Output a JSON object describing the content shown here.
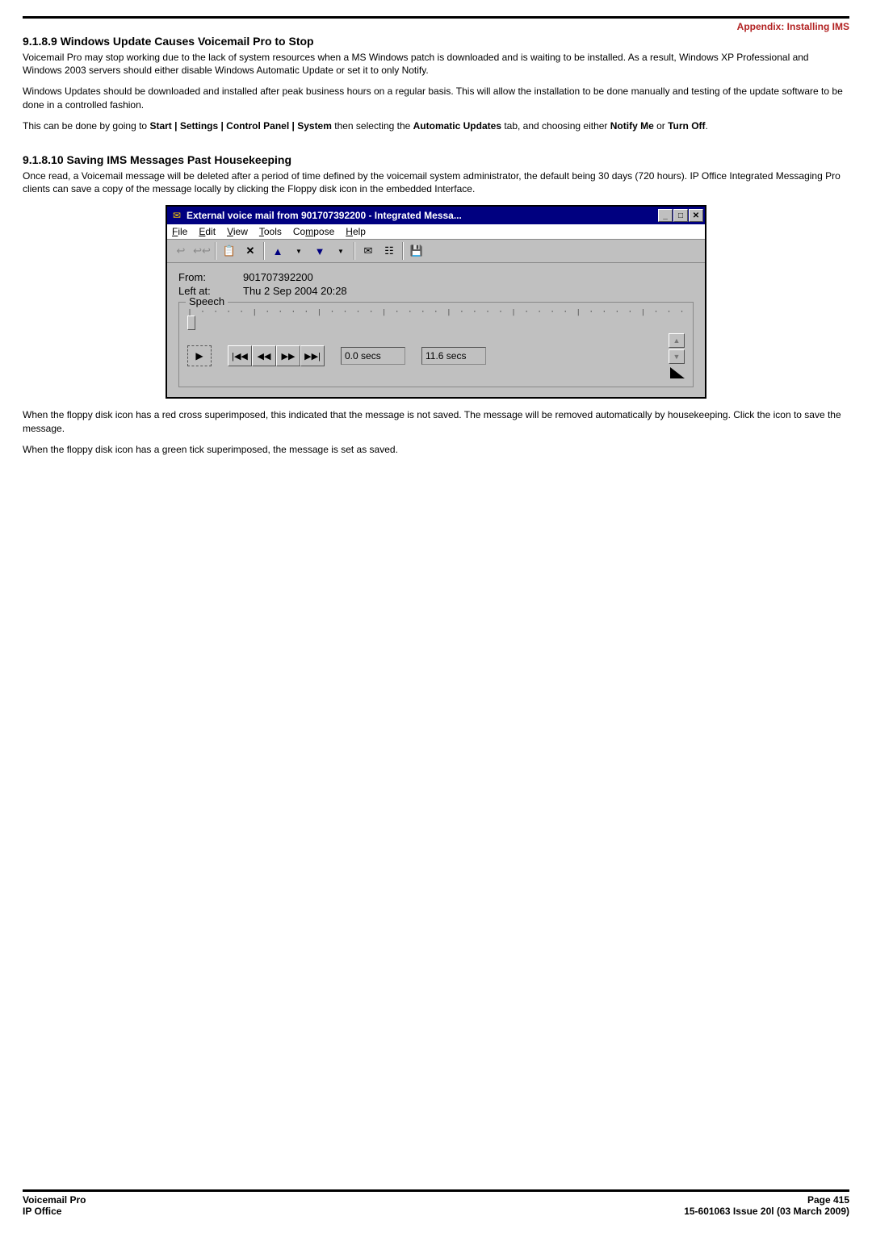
{
  "header": {
    "appendix": "Appendix: Installing IMS"
  },
  "section1": {
    "title": "9.1.8.9 Windows Update Causes Voicemail Pro to Stop",
    "p1": "Voicemail Pro may stop working due to the lack of system resources when a MS Windows patch is downloaded and is waiting to be installed. As a result, Windows XP Professional and Windows 2003 servers should either disable Windows Automatic Update or set it to only Notify.",
    "p2": "Windows Updates should be downloaded and installed after peak business hours on a regular basis. This will allow the installation to be done manually and testing of the update software to be done in a controlled fashion.",
    "p3_a": "This can be done by going to ",
    "p3_b": "Start | Settings | Control Panel | System",
    "p3_c": " then selecting the ",
    "p3_d": "Automatic Updates",
    "p3_e": " tab, and choosing either ",
    "p3_f": "Notify Me",
    "p3_g": " or ",
    "p3_h": "Turn Off",
    "p3_i": "."
  },
  "section2": {
    "title": "9.1.8.10 Saving IMS Messages Past Housekeeping",
    "p1": "Once read, a Voicemail message will be deleted after a period of time defined by the voicemail system administrator, the default being 30 days (720 hours). IP Office Integrated Messaging Pro clients can save a copy of the message locally by clicking the Floppy disk icon in the embedded Interface.",
    "p2": "When the floppy disk icon has a red cross superimposed, this indicated that the message is not saved. The message will be removed automatically by housekeeping. Click the icon to save the message.",
    "p3": "When the floppy disk icon has a green tick superimposed, the message is set as saved."
  },
  "dialog": {
    "title": "External voice mail from 901707392200 - Integrated Messa...",
    "menu": {
      "file": "File",
      "edit": "Edit",
      "view": "View",
      "tools": "Tools",
      "compose": "Compose",
      "help": "Help"
    },
    "info": {
      "from_label": "From:",
      "from_value": "901707392200",
      "left_label": "Left at:",
      "left_value": "Thu 2 Sep 2004  20:28"
    },
    "speech": {
      "legend": "Speech",
      "t1": "0.0 secs",
      "t2": "11.6 secs"
    }
  },
  "footer": {
    "left1": "Voicemail Pro",
    "left2": "IP Office",
    "right1": "Page 415",
    "right2": "15-601063 Issue 20l (03 March 2009)"
  }
}
